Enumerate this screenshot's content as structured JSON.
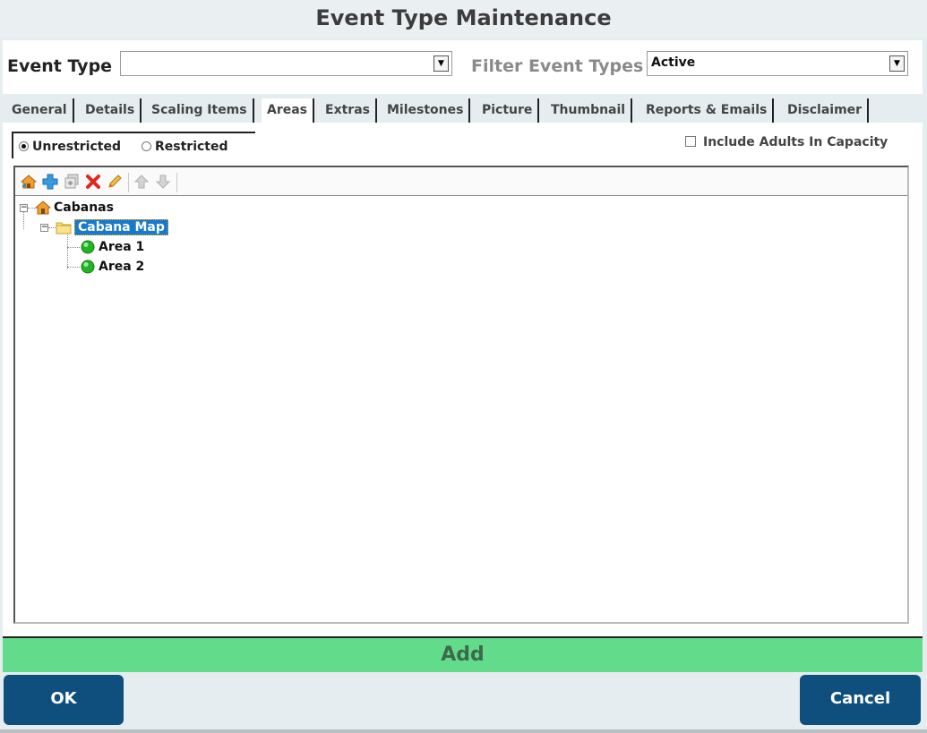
{
  "window": {
    "title": "Event Type Maintenance"
  },
  "header": {
    "event_type_label": "Event Type",
    "event_type_value": "",
    "filter_label": "Filter Event Types",
    "filter_value": "Active"
  },
  "tabs": [
    {
      "label": "General",
      "active": false
    },
    {
      "label": "Details",
      "active": false
    },
    {
      "label": "Scaling Items",
      "active": false
    },
    {
      "label": "Areas",
      "active": true
    },
    {
      "label": "Extras",
      "active": false
    },
    {
      "label": "Milestones",
      "active": false
    },
    {
      "label": "Picture",
      "active": false
    },
    {
      "label": "Thumbnail",
      "active": false
    },
    {
      "label": "Reports & Emails",
      "active": false
    },
    {
      "label": "Disclaimer",
      "active": false
    }
  ],
  "restriction": {
    "unrestricted_label": "Unrestricted",
    "restricted_label": "Restricted",
    "selected": "unrestricted"
  },
  "include_adults": {
    "label": "Include Adults In Capacity",
    "checked": false
  },
  "toolbar_icons": [
    "home-icon",
    "add-icon",
    "copy-icon",
    "delete-icon",
    "edit-icon",
    "move-up-icon",
    "move-down-icon"
  ],
  "tree": {
    "root": {
      "label": "Cabanas",
      "icon": "house-icon"
    },
    "map": {
      "label": "Cabana Map",
      "icon": "folder-icon",
      "selected": true
    },
    "areas": [
      {
        "label": "Area 1",
        "icon": "green-dot-icon"
      },
      {
        "label": "Area 2",
        "icon": "green-dot-icon"
      }
    ]
  },
  "actions": {
    "add_label": "Add",
    "ok_label": "OK",
    "cancel_label": "Cancel"
  },
  "colors": {
    "accent": "#0e4f7e",
    "add_bar": "#62dc8a",
    "selection": "#1979ca",
    "status_green": "#22b422"
  }
}
